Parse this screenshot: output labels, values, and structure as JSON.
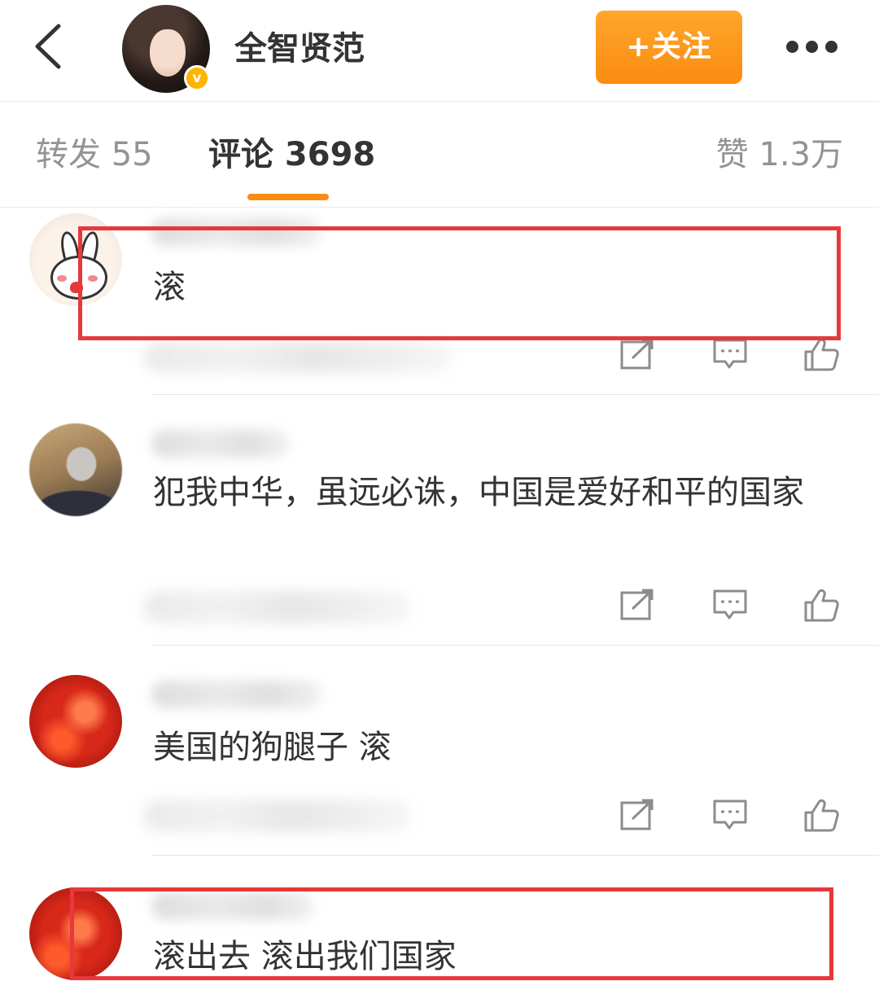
{
  "header": {
    "back_icon": "chevron-left-icon",
    "username": "全智贤范",
    "verified_badge": "v",
    "follow_label": "+关注",
    "more_icon": "more-horizontal-icon",
    "accent_color": "#fb8c12"
  },
  "tabs": [
    {
      "label": "转发 55",
      "active": false
    },
    {
      "label": "评论 3698",
      "active": true
    },
    {
      "label": "赞 1.3万",
      "active": false
    }
  ],
  "comments": [
    {
      "text": "滚",
      "highlighted": true
    },
    {
      "text": "犯我中华，虽远必诛，中国是爱好和平的国家",
      "highlighted": false
    },
    {
      "text": "美国的狗腿子 滚",
      "highlighted": false
    },
    {
      "text": "滚出去 滚出我们国家",
      "highlighted": true
    }
  ],
  "actions": {
    "repost_icon": "repost-icon",
    "reply_icon": "comment-icon",
    "like_icon": "thumbs-up-icon"
  },
  "highlight_color": "#e5393b"
}
